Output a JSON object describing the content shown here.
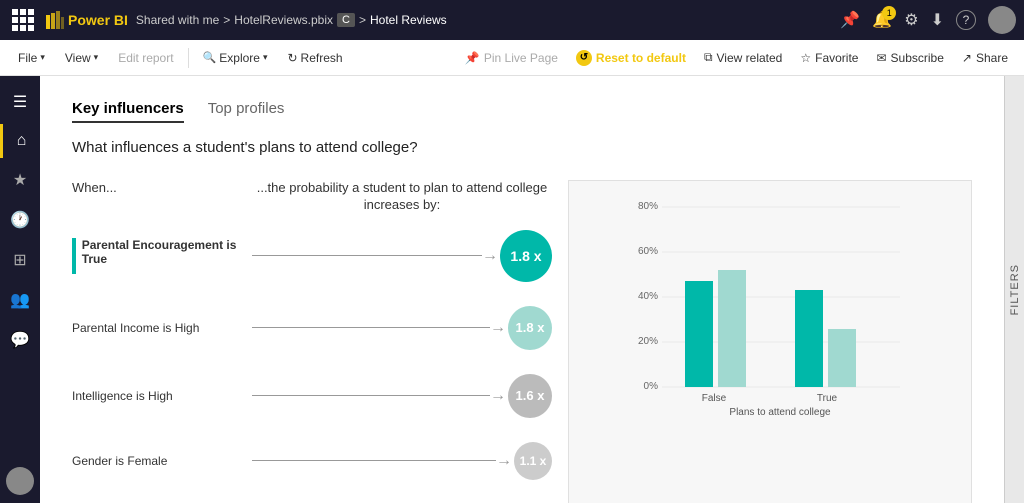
{
  "topbar": {
    "app_name": "Power BI",
    "breadcrumb": {
      "shared_with_me": "Shared with me",
      "sep1": ">",
      "file_name": "HotelReviews.pbix",
      "lock_label": "C",
      "sep2": ">",
      "report_name": "Hotel Reviews"
    },
    "icons": {
      "pin": "📌",
      "bell": "🔔",
      "notif_count": "1",
      "settings": "⚙",
      "download": "⬇",
      "help": "?",
      "profile": "👤"
    }
  },
  "toolbar2": {
    "file_label": "File",
    "view_label": "View",
    "edit_label": "Edit report",
    "explore_label": "Explore",
    "refresh_label": "Refresh",
    "pin_live": "Pin Live Page",
    "reset": "Reset to default",
    "view_related": "View related",
    "favorite": "Favorite",
    "subscribe": "Subscribe",
    "share": "Share"
  },
  "sidebar": {
    "items": [
      {
        "icon": "☰",
        "name": "menu"
      },
      {
        "icon": "⌂",
        "name": "home"
      },
      {
        "icon": "★",
        "name": "favorites"
      },
      {
        "icon": "🕐",
        "name": "recent"
      },
      {
        "icon": "📊",
        "name": "apps"
      },
      {
        "icon": "👥",
        "name": "shared"
      },
      {
        "icon": "💬",
        "name": "messages"
      }
    ]
  },
  "main": {
    "tabs": [
      {
        "label": "Key influencers",
        "active": true
      },
      {
        "label": "Top profiles",
        "active": false
      }
    ],
    "question": "What influences a student's plans to attend college?",
    "col_when": "When...",
    "col_prob": "...the probability a student to plan to attend college increases by:",
    "influencers": [
      {
        "label": "Parental Encouragement is True",
        "active": true,
        "value": "1.8 x",
        "bubble_type": "teal-lg"
      },
      {
        "label": "Parental Income is High",
        "active": false,
        "value": "1.8 x",
        "bubble_type": "teal-sm"
      },
      {
        "label": "Intelligence is High",
        "active": false,
        "value": "1.6 x",
        "bubble_type": "gray"
      },
      {
        "label": "Gender is Female",
        "active": false,
        "value": "1.1 x",
        "bubble_type": "gray-sm"
      }
    ],
    "chart": {
      "y_labels": [
        "80%",
        "60%",
        "40%",
        "20%",
        "0%"
      ],
      "x_labels": [
        "False",
        "True"
      ],
      "x_title": "Plans to attend college",
      "bars": {
        "false_bar1_height_pct": 47,
        "false_bar2_height_pct": 65,
        "true_bar1_height_pct": 54,
        "true_bar2_height_pct": 32
      },
      "colors": {
        "bar1": "#00b8a9",
        "bar2": "#a0d9d0"
      }
    },
    "filters_label": "FILTERS"
  }
}
